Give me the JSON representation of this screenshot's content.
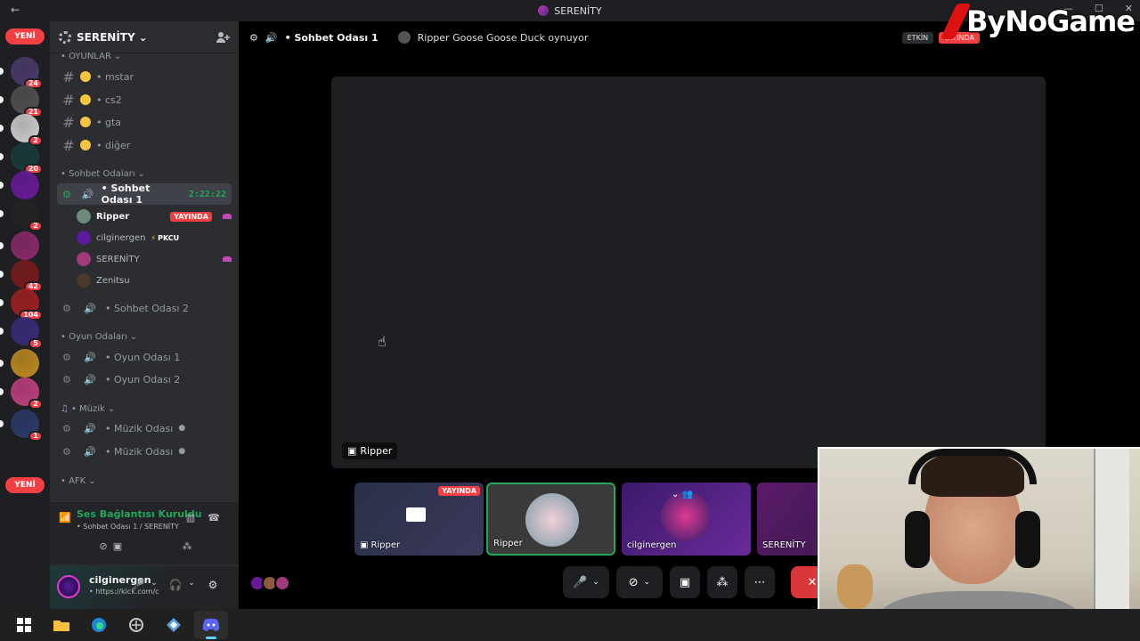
{
  "window": {
    "title": "SERENİTY",
    "back": "←"
  },
  "watermark": {
    "text": "ByNoGame"
  },
  "guild_bar": {
    "new_top": "YENİ",
    "new_bottom": "YENİ",
    "guilds": [
      {
        "badge": "24",
        "color": "#4a3a6a"
      },
      {
        "badge": "21",
        "color": "#505050"
      },
      {
        "badge": "2",
        "color": "#d0d0d0"
      },
      {
        "badge": "20",
        "color": "#1a3a3a"
      },
      {
        "badge": "",
        "color": "#6a1a9a"
      },
      {
        "badge": "2",
        "color": "#222222"
      },
      {
        "badge": "",
        "color": "#8a2a6a"
      },
      {
        "badge": "42",
        "color": "#7a1a1a"
      },
      {
        "badge": "104",
        "color": "#a02020"
      },
      {
        "badge": "5",
        "color": "#3a2a7a"
      },
      {
        "badge": "",
        "color": "#c08a20"
      },
      {
        "badge": "2",
        "color": "#c04080"
      },
      {
        "badge": "1",
        "color": "#2a3a6a"
      }
    ]
  },
  "server": {
    "name": "SERENİTY",
    "chevron": "⌄"
  },
  "categories": {
    "oyunlar": "• OYUNLAR",
    "sohbet": "• Sohbet Odaları",
    "oyun": "• Oyun Odaları",
    "muzik": "• Müzik",
    "afk": "• AFK"
  },
  "text_channels": [
    {
      "name": "• mstar"
    },
    {
      "name": "• cs2"
    },
    {
      "name": "• gta"
    },
    {
      "name": "• diğer"
    }
  ],
  "voice_channels": {
    "active": {
      "name": "• Sohbet Odası 1",
      "timer": "2:22:22"
    },
    "sohbet2": "• Sohbet Odası 2",
    "oyun1": "• Oyun Odası 1",
    "oyun2": "• Oyun Odası 2",
    "muzik1": "• Müzik Odası",
    "muzik2": "• Müzik Odası"
  },
  "voice_users": [
    {
      "name": "Ripper",
      "live": "YAYINDA"
    },
    {
      "name": "cilginergen",
      "tag": "PKCU"
    },
    {
      "name": "SERENİTY"
    },
    {
      "name": "Zenitsu"
    }
  ],
  "voice_panel": {
    "status": "Ses Bağlantısı Kuruldu",
    "sub": "• Sohbet Odası 1 / SERENİTY"
  },
  "user_panel": {
    "name": "cilginergen",
    "status": "• https://kick.com/c"
  },
  "topbar": {
    "channel": "• Sohbet Odası 1",
    "activity": "Ripper Goose Goose Duck oynuyor",
    "etkin": "ETKİN",
    "yayinda": "YAYINDA"
  },
  "stage": {
    "label": "Ripper"
  },
  "tiles": [
    {
      "name": "Ripper",
      "live": "YAYINDA"
    },
    {
      "name": "Ripper"
    },
    {
      "name": "cilginergen"
    },
    {
      "name": "SERENİTY"
    }
  ],
  "colors": {
    "accent": "#23a55a",
    "danger": "#da373c",
    "live": "#f23f43",
    "blurple": "#5865f2"
  }
}
